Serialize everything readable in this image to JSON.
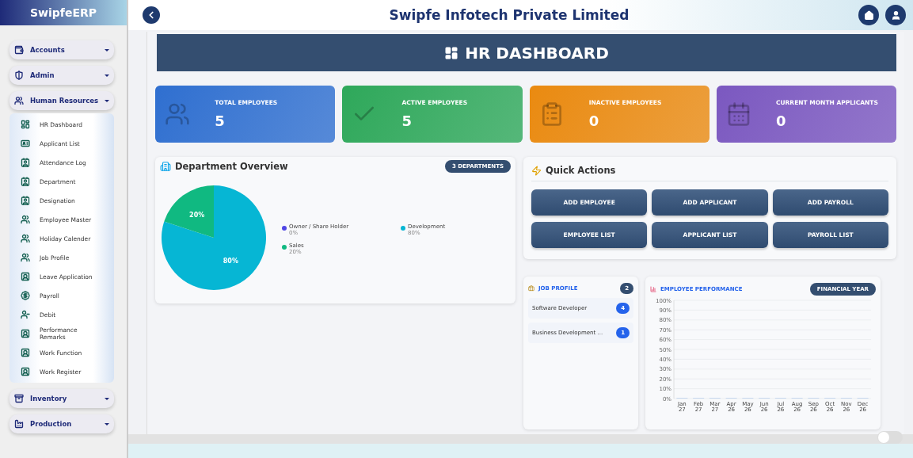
{
  "sidebar": {
    "brand": "SwipfeERP",
    "groups": [
      {
        "label": "Accounts"
      },
      {
        "label": "Admin"
      },
      {
        "label": "Human Resources",
        "children": [
          {
            "label": "HR Dashboard"
          },
          {
            "label": "Applicant List"
          },
          {
            "label": "Attendance Log"
          },
          {
            "label": "Department"
          },
          {
            "label": "Designation"
          },
          {
            "label": "Employee Master"
          },
          {
            "label": "Holiday Calender"
          },
          {
            "label": "Job Profile"
          },
          {
            "label": "Leave Application"
          },
          {
            "label": "Payroll"
          },
          {
            "label": "Debit"
          },
          {
            "label": "Performance Remarks"
          },
          {
            "label": "Work Function"
          },
          {
            "label": "Work Register"
          }
        ]
      },
      {
        "label": "Inventory"
      },
      {
        "label": "Production"
      }
    ]
  },
  "header": {
    "title": "Swipfe Infotech Private Limited"
  },
  "banner": {
    "title": "HR DASHBOARD"
  },
  "stats": [
    {
      "label": "TOTAL EMPLOYEES",
      "value": "5",
      "color": "#2f6fd0"
    },
    {
      "label": "ACTIVE EMPLOYEES",
      "value": "5",
      "color": "#2ea85a"
    },
    {
      "label": "INACTIVE EMPLOYEES",
      "value": "0",
      "color": "#ea8a10"
    },
    {
      "label": "CURRENT MONTH APPLICANTS",
      "value": "0",
      "color": "#7b58c0"
    }
  ],
  "department_overview": {
    "title": "Department Overview",
    "badge": "3 DEPARTMENTS",
    "legend": [
      {
        "percent": "0%",
        "color": "#4f46e5"
      },
      {
        "percent": "80%",
        "color": "#06b6d4"
      },
      {
        "percent": "20%",
        "color": "#10b981"
      }
    ],
    "chart_data": {
      "type": "pie",
      "categories": [
        "Owner / Share Holder",
        "Development",
        "Sales"
      ],
      "values": [
        0,
        80,
        20
      ],
      "value_labels": [
        null,
        "80%",
        "20%"
      ]
    }
  },
  "quick_actions": {
    "title": "Quick Actions",
    "buttons": [
      "ADD EMPLOYEE",
      "ADD APPLICANT",
      "ADD PAYROLL",
      "EMPLOYEE LIST",
      "APPLICANT LIST",
      "PAYROLL LIST"
    ]
  },
  "job_profile": {
    "title": "JOB PROFILE",
    "count": "2",
    "items": [
      {
        "name": "Software Developer",
        "count": "4"
      },
      {
        "name": "Business Development ...",
        "count": "1"
      }
    ]
  },
  "employee_performance": {
    "title": "EMPLOYEE PERFORMANCE",
    "badge": "FINANCIAL YEAR",
    "chart_data": {
      "type": "bar",
      "categories": [
        "Jan 27",
        "Feb 27",
        "Mar 27",
        "Apr 26",
        "May 26",
        "Jun 26",
        "Jul 26",
        "Aug 26",
        "Sep 26",
        "Oct 26",
        "Nov 26",
        "Dec 26"
      ],
      "values": [
        0,
        0,
        0,
        0,
        0,
        0,
        0,
        0,
        0,
        0,
        0,
        0
      ],
      "grid": true,
      "ylim": [
        0,
        100
      ],
      "yticks": [
        {
          "value": 0,
          "label": "0%"
        },
        {
          "value": 10,
          "label": "10%"
        },
        {
          "value": 20,
          "label": "20%"
        },
        {
          "value": 30,
          "label": "30%"
        },
        {
          "value": 40,
          "label": "40%"
        },
        {
          "value": 50,
          "label": "50%"
        },
        {
          "value": 60,
          "label": "60%"
        },
        {
          "value": 70,
          "label": "70%"
        },
        {
          "value": 80,
          "label": "80%"
        },
        {
          "value": 90,
          "label": "90%"
        },
        {
          "value": 100,
          "label": "100%"
        }
      ]
    }
  },
  "theme_toggle": {
    "on": false
  }
}
